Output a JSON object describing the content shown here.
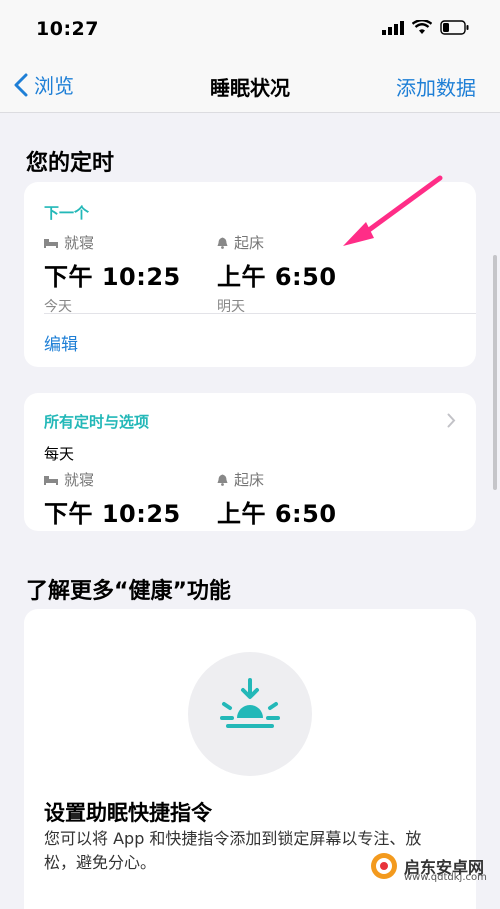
{
  "status": {
    "time": "10:27"
  },
  "nav": {
    "back_label": "浏览",
    "title": "睡眠状况",
    "action_label": "添加数据"
  },
  "timer": {
    "section_title": "您的定时",
    "next_label": "下一个",
    "bedtime_label": "就寝",
    "bedtime_value": "下午 10:25",
    "bedtime_day": "今天",
    "wake_label": "起床",
    "wake_value": "上午 6:50",
    "wake_day": "明天",
    "edit_label": "编辑"
  },
  "schedule": {
    "title": "所有定时与选项",
    "frequency": "每天",
    "bedtime_label": "就寝",
    "bedtime_value": "下午 10:25",
    "wake_label": "起床",
    "wake_value": "上午 6:50"
  },
  "learn": {
    "section_title": "了解更多“健康”功能",
    "card_title": "设置助眠快捷指令",
    "card_body": "您可以将 App 和快捷指令添加到锁定屏幕以专注、放松，避免分心。"
  },
  "watermark": {
    "title": "启东安卓网",
    "url": "www.qdtdkj.com"
  },
  "colors": {
    "accent_blue": "#1e7fd6",
    "teal": "#23b8b8",
    "annotation_arrow": "#ff2d87"
  }
}
